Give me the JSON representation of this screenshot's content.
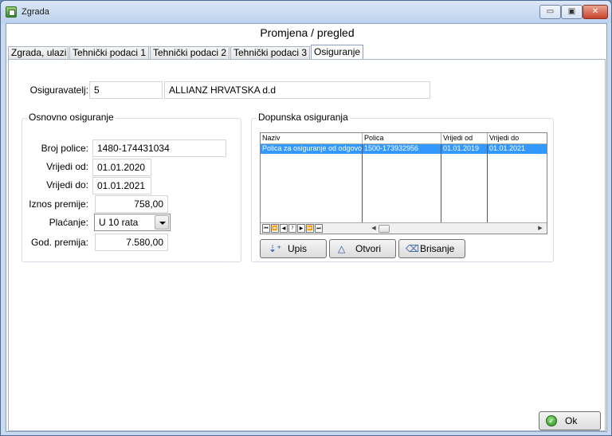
{
  "window": {
    "title": "Zgrada",
    "minimize_glyph": "▭",
    "maximize_glyph": "▣",
    "close_glyph": "✕"
  },
  "header": {
    "title": "Promjena / pregled"
  },
  "tabs": [
    {
      "label": "Zgrada, ulazi",
      "active": false
    },
    {
      "label": "Tehnički podaci 1",
      "active": false
    },
    {
      "label": "Tehnički podaci 2",
      "active": false
    },
    {
      "label": "Tehnički podaci 3",
      "active": false
    },
    {
      "label": "Osiguranje",
      "active": true
    }
  ],
  "insurer": {
    "label": "Osiguravatelj:",
    "code": "5",
    "name": "ALLIANZ HRVATSKA d.d"
  },
  "basic_insurance": {
    "group_title": "Osnovno osiguranje",
    "policy_number_label": "Broj police:",
    "policy_number": "1480-174431034",
    "valid_from_label": "Vrijedi od:",
    "valid_from": "01.01.2020",
    "valid_to_label": "Vrijedi do:",
    "valid_to": "01.01.2021",
    "premium_label": "Iznos premije:",
    "premium": "758,00",
    "payment_label": "Plaćanje:",
    "payment_value": "U 10 rata",
    "annual_premium_label": "God. premija:",
    "annual_premium": "7.580,00"
  },
  "additional_insurance": {
    "group_title": "Dopunska osiguranja",
    "columns": [
      "Naziv",
      "Polica",
      "Vrijedi od",
      "Vrijedi do"
    ],
    "rows": [
      [
        "Polica za osiguranje od odgovo",
        "1500-173932956",
        "01.01.2019",
        "01.01.2021"
      ]
    ],
    "nav_buttons": [
      "⏮",
      "⏪",
      "◀",
      "?",
      "▶",
      "⏩",
      "⏭"
    ],
    "scroll_left": "◀",
    "scroll_right": "▶",
    "buttons": {
      "add": "Upis",
      "open": "Otvori",
      "delete": "Brisanje"
    }
  },
  "footer": {
    "ok_label": "Ok"
  },
  "colors": {
    "selection": "#3399ff",
    "titlebar": "#c9d9ee"
  }
}
